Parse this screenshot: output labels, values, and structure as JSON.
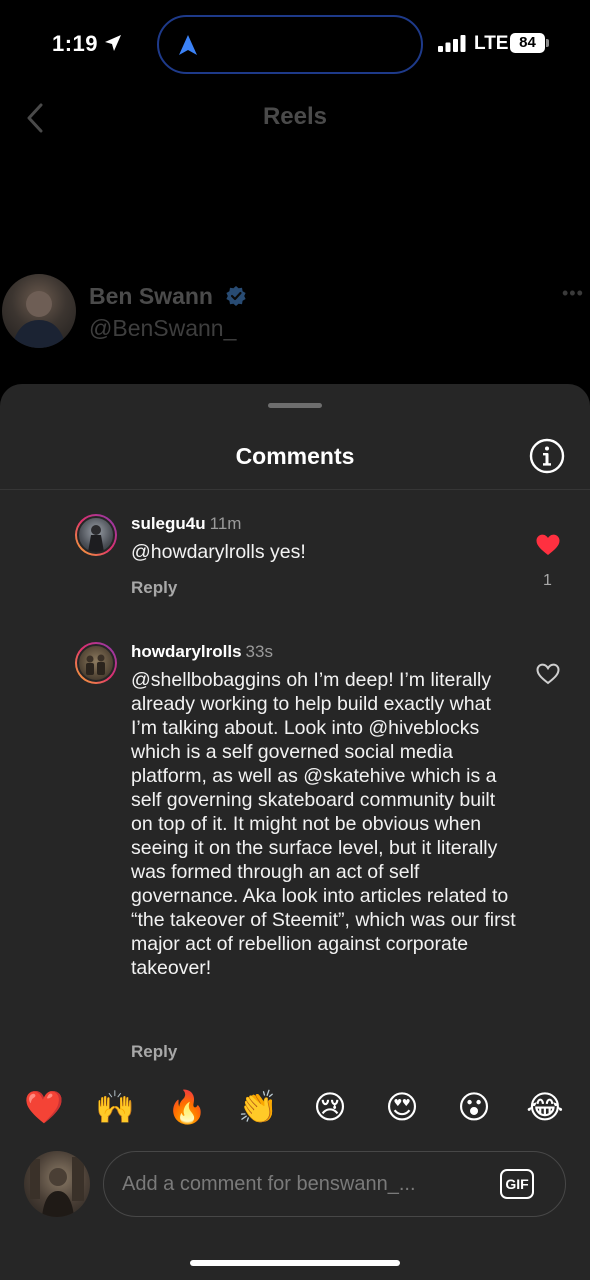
{
  "status_bar": {
    "time": "1:19",
    "network": "LTE",
    "battery": "84"
  },
  "header": {
    "title": "Reels"
  },
  "creator": {
    "name": "Ben Swann",
    "handle": "@BenSwann_",
    "more": "•••"
  },
  "sheet": {
    "title": "Comments"
  },
  "comments": [
    {
      "username": "sulegu4u",
      "time": "11m",
      "text": "@howdarylrolls yes!",
      "reply_label": "Reply",
      "liked": true,
      "like_count": "1"
    },
    {
      "username": "howdarylrolls",
      "time": "33s",
      "text": "@shellbobaggins oh I’m deep!  I’m literally already working to help build exactly what I’m talking about.  Look into @hiveblocks which is a self governed social media platform, as well as @skatehive which is a self governing skateboard community built on top of it.  It might not be obvious when seeing it on the surface level, but it literally was formed through an act of self governance.  Aka look into articles related to “the takeover of Steemit”, which was our first major act of rebellion against corporate takeover!",
      "reply_label": "Reply",
      "liked": false,
      "like_count": ""
    }
  ],
  "emoji_bar": [
    "❤️",
    "🙌",
    "🔥",
    "👏",
    "😢",
    "😍",
    "😮",
    "😂"
  ],
  "composer": {
    "placeholder": "Add a comment for benswann_...",
    "gif_label": "GIF"
  },
  "colors": {
    "sheet_bg": "#262626",
    "like_red": "#ff3040",
    "verified_blue": "#3897f0",
    "island_border": "#1e3a8a"
  }
}
